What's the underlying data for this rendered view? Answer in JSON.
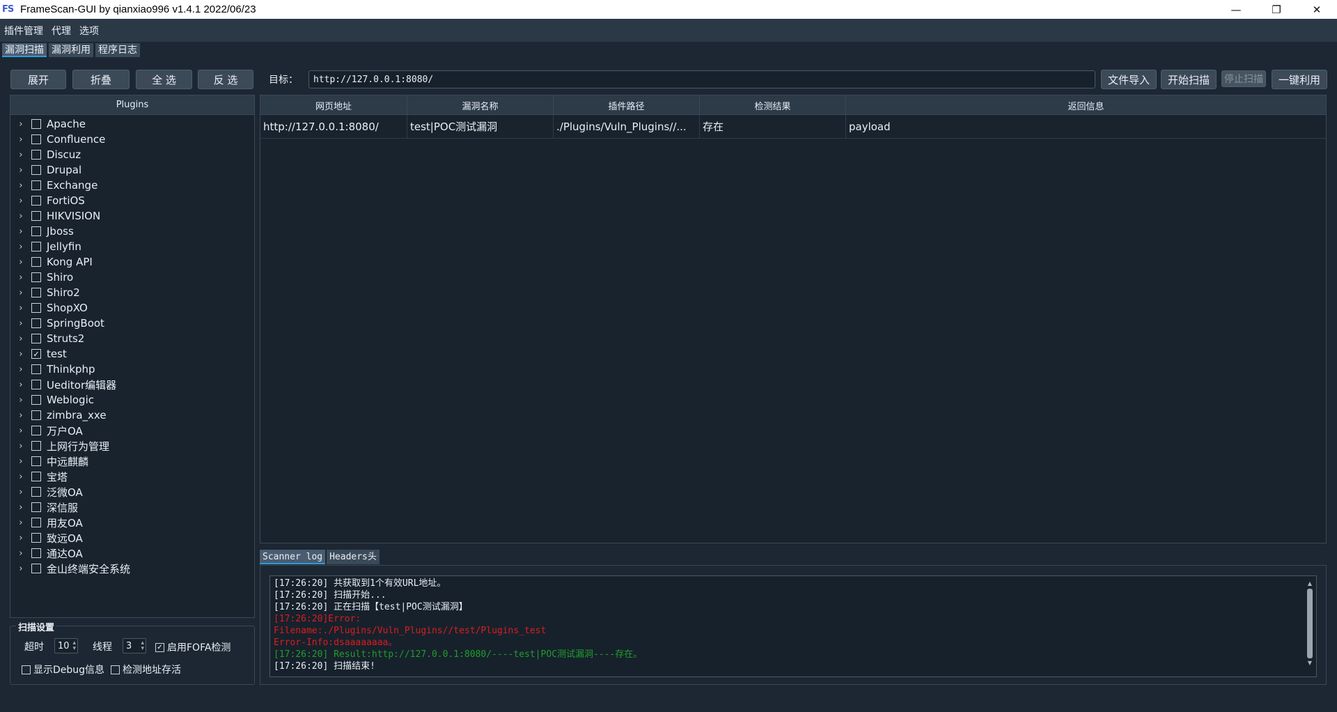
{
  "window": {
    "icon_text": "FS",
    "title": "FrameScan-GUI  by qianxiao996 v1.4.1 2022/06/23",
    "minimize": "—",
    "maximize": "❐",
    "close": "✕"
  },
  "menu": [
    "插件管理",
    "代理",
    "选项"
  ],
  "tabs": [
    "漏洞扫描",
    "漏洞利用",
    "程序日志"
  ],
  "toolbar": {
    "expand": "展开",
    "collapse": "折叠",
    "select_all": "全  选",
    "invert": "反  选",
    "target_label": "目标：",
    "target_value": "http://127.0.0.1:8080/",
    "import": "文件导入",
    "start": "开始扫描",
    "stop": "停止扫描",
    "exploit": "一键利用"
  },
  "plugins": {
    "header": "Plugins",
    "items": [
      {
        "label": "Apache",
        "checked": false
      },
      {
        "label": "Confluence",
        "checked": false
      },
      {
        "label": "Discuz",
        "checked": false
      },
      {
        "label": "Drupal",
        "checked": false
      },
      {
        "label": "Exchange",
        "checked": false
      },
      {
        "label": "FortiOS",
        "checked": false
      },
      {
        "label": "HIKVISION",
        "checked": false
      },
      {
        "label": "Jboss",
        "checked": false
      },
      {
        "label": "Jellyfin",
        "checked": false
      },
      {
        "label": "Kong API",
        "checked": false
      },
      {
        "label": "Shiro",
        "checked": false
      },
      {
        "label": "Shiro2",
        "checked": false
      },
      {
        "label": "ShopXO",
        "checked": false
      },
      {
        "label": "SpringBoot",
        "checked": false
      },
      {
        "label": "Struts2",
        "checked": false
      },
      {
        "label": "test",
        "checked": true
      },
      {
        "label": "Thinkphp",
        "checked": false
      },
      {
        "label": "Ueditor编辑器",
        "checked": false
      },
      {
        "label": "Weblogic",
        "checked": false
      },
      {
        "label": "zimbra_xxe",
        "checked": false
      },
      {
        "label": "万户OA",
        "checked": false
      },
      {
        "label": "上网行为管理",
        "checked": false
      },
      {
        "label": "中远麒麟",
        "checked": false
      },
      {
        "label": "宝塔",
        "checked": false
      },
      {
        "label": "泛微OA",
        "checked": false
      },
      {
        "label": "深信服",
        "checked": false
      },
      {
        "label": "用友OA",
        "checked": false
      },
      {
        "label": "致远OA",
        "checked": false
      },
      {
        "label": "通达OA",
        "checked": false
      },
      {
        "label": "金山终端安全系统",
        "checked": false
      }
    ]
  },
  "settings": {
    "title": "扫描设置",
    "timeout_label": "超时",
    "timeout_value": "10",
    "threads_label": "线程",
    "threads_value": "3",
    "fofa_label": "启用FOFA检测",
    "fofa_checked": true,
    "debug_label": "显示Debug信息",
    "debug_checked": false,
    "alive_label": "检测地址存活",
    "alive_checked": false
  },
  "table": {
    "columns": [
      "网页地址",
      "漏洞名称",
      "插件路径",
      "检测结果",
      "返回信息"
    ],
    "rows": [
      [
        "http://127.0.0.1:8080/",
        "test|POC测试漏洞",
        "./Plugins/Vuln_Plugins//...",
        "存在",
        "payload"
      ]
    ]
  },
  "log_tabs": [
    "Scanner log",
    "Headers头"
  ],
  "log": [
    {
      "text": "[17:26:20] 共获取到1个有效URL地址。",
      "type": "normal"
    },
    {
      "text": "[17:26:20] 扫描开始...",
      "type": "normal"
    },
    {
      "text": "[17:26:20] 正在扫描【test|POC测试漏洞】",
      "type": "normal"
    },
    {
      "text": "[17:26:20]Error:",
      "type": "error"
    },
    {
      "text": "Filename:./Plugins/Vuln_Plugins//test/Plugins_test",
      "type": "error"
    },
    {
      "text": "Error-Info:dsaaaaaaaa。",
      "type": "error"
    },
    {
      "text": "[17:26:20] Result:http://127.0.0.1:8080/----test|POC测试漏洞----存在。",
      "type": "result"
    },
    {
      "text": "[17:26:20] 扫描结束!",
      "type": "normal"
    }
  ],
  "colors": {
    "background": "#1c2733",
    "panel": "#19232e",
    "accent": "#2d9cdb",
    "error": "#d81e1e",
    "success": "#1f9e2a"
  }
}
